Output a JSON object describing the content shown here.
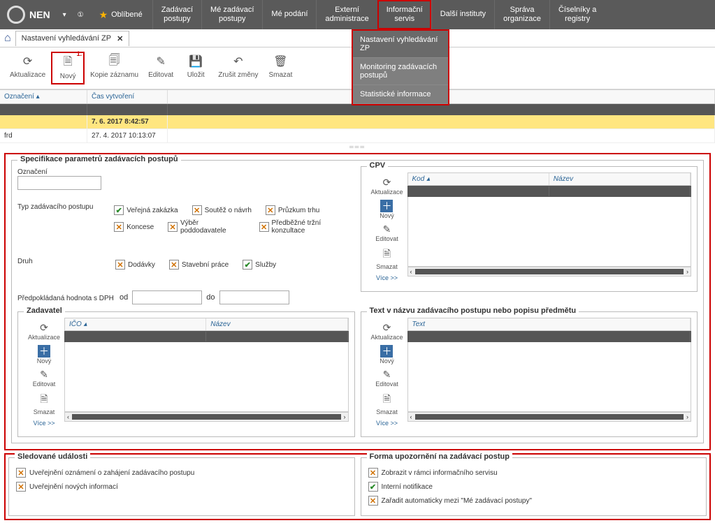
{
  "app": {
    "name": "NEN"
  },
  "topmenu": {
    "fav": "Oblíbené",
    "items": [
      [
        "Zadávací",
        "postupy"
      ],
      [
        "Mé zadávací",
        "postupy"
      ],
      [
        "Mé podání",
        ""
      ],
      [
        "Externí",
        "administrace"
      ],
      [
        "Informační",
        "servis"
      ],
      [
        "Další instituty",
        ""
      ],
      [
        "Správa",
        "organizace"
      ],
      [
        "Číselníky a",
        "registry"
      ]
    ]
  },
  "dropdown": {
    "items": [
      "Nastavení vyhledávání ZP",
      "Monitoring zadávacích postupů",
      "Statistické informace"
    ]
  },
  "tab": {
    "title": "Nastavení vyhledávání ZP"
  },
  "toolbar": {
    "aktualizace": "Aktualizace",
    "novy": "Nový",
    "novy_num": "1.",
    "kopie": "Kopie záznamu",
    "editovat": "Editovat",
    "ulozit": "Uložit",
    "zrusit": "Zrušit změny",
    "smazat": "Smazat"
  },
  "grid": {
    "cols": {
      "oznaceni": "Označení",
      "cas": "Čas vytvoření"
    },
    "rows": [
      {
        "oznaceni": "",
        "cas": "7. 6. 2017 8:42:57",
        "sel": true
      },
      {
        "oznaceni": "frd",
        "cas": "27. 4. 2017 10:13:07",
        "sel": false
      }
    ]
  },
  "spec": {
    "title": "Specifikace parametrů zadávacích postupů",
    "oznaceni": "Označení",
    "typ_label": "Typ zadávacího postupu",
    "typ": [
      {
        "label": "Veřejná zakázka",
        "state": "g"
      },
      {
        "label": "Soutěž o návrh",
        "state": "x"
      },
      {
        "label": "Průzkum trhu",
        "state": "x"
      },
      {
        "label": "Koncese",
        "state": "x"
      },
      {
        "label": "Výběr poddodavatele",
        "state": "x"
      },
      {
        "label": "Předběžné tržní konzultace",
        "state": "x"
      }
    ],
    "druh_label": "Druh",
    "druh": [
      {
        "label": "Dodávky",
        "state": "x"
      },
      {
        "label": "Stavební práce",
        "state": "x"
      },
      {
        "label": "Služby",
        "state": "g"
      }
    ],
    "hodnota_label": "Předpokládaná hodnota s DPH",
    "od": "od",
    "do": "do"
  },
  "cpv": {
    "title": "CPV",
    "kod": "Kod",
    "nazev": "Název"
  },
  "zadavatel": {
    "title": "Zadavatel",
    "ico": "IČO",
    "nazev": "Název"
  },
  "textnazev": {
    "title": "Text v názvu zadávacího postupu nebo popisu předmětu",
    "col": "Text"
  },
  "minitools": {
    "aktualizace": "Aktualizace",
    "novy": "Nový",
    "editovat": "Editovat",
    "smazat": "Smazat",
    "vice": "Více >>"
  },
  "events": {
    "title": "Sledované události",
    "items": [
      {
        "label": "Uveřejnění oznámení o zahájení zadávacího postupu",
        "state": "x"
      },
      {
        "label": "Uveřejnění nových informací",
        "state": "x"
      }
    ]
  },
  "alerts": {
    "title": "Forma upozornění na zadávací postup",
    "items": [
      {
        "label": "Zobrazit v rámci informačního servisu",
        "state": "x"
      },
      {
        "label": "Interní notifikace",
        "state": "g"
      },
      {
        "label": "Zařadit automaticky mezi \"Mé zadávací postupy\"",
        "state": "x"
      }
    ]
  }
}
